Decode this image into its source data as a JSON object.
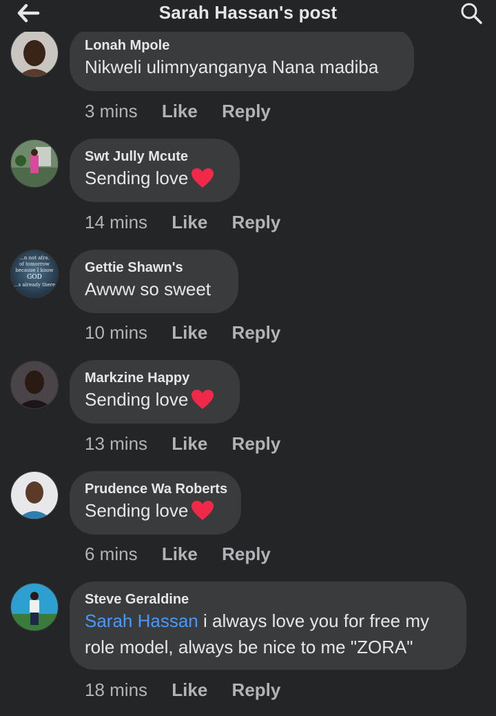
{
  "header": {
    "title": "Sarah Hassan's post",
    "back_icon": "arrow-left-icon",
    "search_icon": "search-icon"
  },
  "colors": {
    "background": "#242526",
    "bubble": "#3a3b3c",
    "mention": "#4599ff",
    "heart": "#f02849"
  },
  "comments": [
    {
      "author": "Lonah Mpole",
      "text": "Nikweli ulimnyanganya Nana madiba",
      "time": "3 mins",
      "like": "Like",
      "reply": "Reply"
    },
    {
      "author": "Swt Jully Mcute",
      "text": "Sending love",
      "emoji": "red-heart",
      "time": "14 mins",
      "like": "Like",
      "reply": "Reply"
    },
    {
      "author": "Gettie Shawn's",
      "text": "Awww so sweet",
      "time": "10 mins",
      "like": "Like",
      "reply": "Reply",
      "avatar_text": [
        "...n not afra.",
        "of tomorrow",
        "because I know",
        "GOD",
        "...s already there"
      ]
    },
    {
      "author": "Markzine Happy",
      "text": "Sending love",
      "emoji": "red-heart",
      "time": "13 mins",
      "like": "Like",
      "reply": "Reply"
    },
    {
      "author": "Prudence Wa Roberts",
      "text": "Sending love",
      "emoji": "red-heart",
      "time": "6 mins",
      "like": "Like",
      "reply": "Reply"
    },
    {
      "author": "Steve Geraldine",
      "mention": "Sarah Hassan",
      "text": " i always love you for free my role model,  always be nice to me \"ZORA\"",
      "time": "18 mins",
      "like": "Like",
      "reply": "Reply"
    }
  ]
}
